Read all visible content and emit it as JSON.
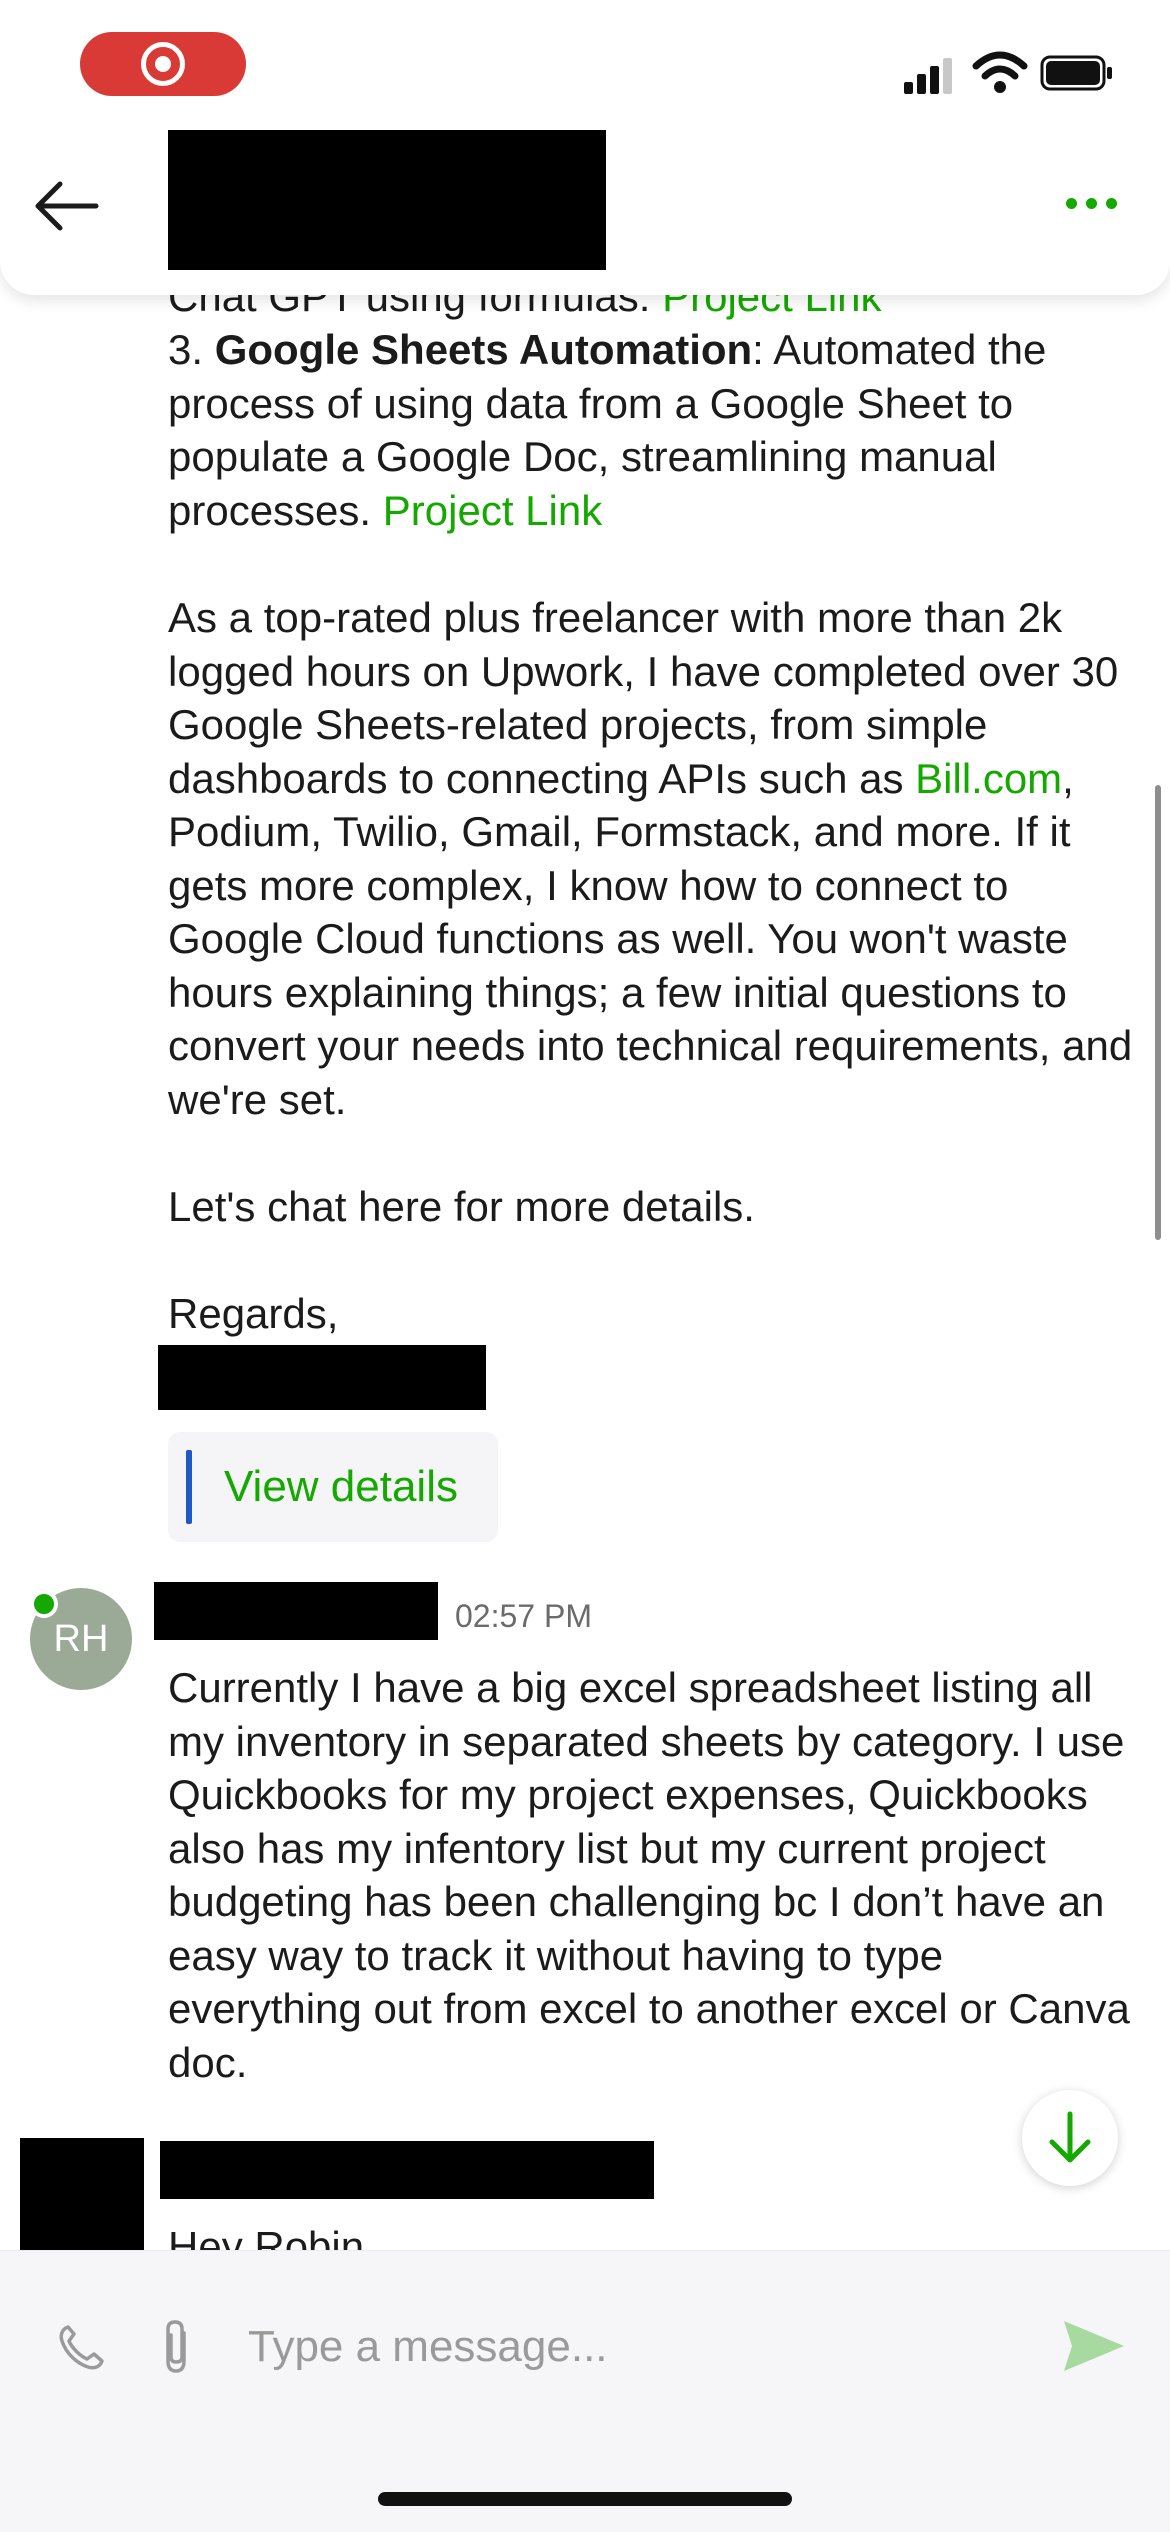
{
  "status_bar": {
    "recording": true
  },
  "header": {
    "title": "",
    "more_label": "..."
  },
  "messages": {
    "cut_line_prefix": "Chat GPT using formulas: ",
    "cut_line_link": "Project Link",
    "item3_prefix": "3. ",
    "item3_title": "Google Sheets Automation",
    "item3_text": ": Automated the process of using data from a Google Sheet to populate a Google Doc, streamlining manual processes. ",
    "item3_link": "Project Link",
    "para_a": "As a top-rated plus freelancer with more than 2k logged hours on Upwork, I have completed over 30 Google Sheets-related projects, from simple dashboards to connecting APIs such as ",
    "para_link": "Bill.com",
    "para_b": ", Podium, Twilio, Gmail, Formstack, and more. If it gets more complex, I know how to connect to Google Cloud functions as well. You won't waste hours explaining things; a few initial questions to convert your needs into technical requirements, and we're set.",
    "chat_line": "Let's chat here for more details.",
    "regards": "Regards,",
    "view_details": "View details"
  },
  "client_message": {
    "avatar_initials": "RH",
    "time": "02:57 PM",
    "text": "Currently I have a big excel spreadsheet listing all my inventory in separated sheets by category. I use Quickbooks for my project expenses, Quickbooks also has my infentory list but my current project budgeting has been challenging bc I don’t have an easy way to track it without having to type everything out from excel to another excel or Canva doc."
  },
  "next_message": {
    "preview": "Hey Robin"
  },
  "composer": {
    "placeholder": "Type a message..."
  },
  "colors": {
    "accent": "#14a800",
    "quote_bar": "#1f57c3",
    "record": "#d93a35"
  },
  "icons": [
    "back-arrow-icon",
    "more-icon",
    "phone-icon",
    "paperclip-icon",
    "send-icon",
    "arrow-down-icon",
    "signal-icon",
    "wifi-icon",
    "battery-icon"
  ]
}
